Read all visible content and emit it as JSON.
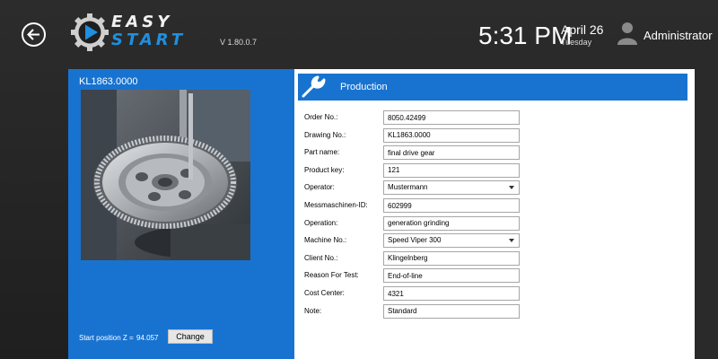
{
  "header": {
    "logo_line1": "EASY",
    "logo_line2": "START",
    "version": "V 1.80.0.7",
    "time": "5:31 PM",
    "date_month_day": "April 26",
    "date_weekday": "Tuesday",
    "user_name": "Administrator",
    "icons": {
      "back": "back-arrow-icon",
      "logo": "gear-play-logo-icon",
      "user": "user-icon"
    }
  },
  "left_panel": {
    "part_id": "KL1863.0000",
    "photo_subject": "gear-image",
    "start_position_label": "Start position Z =",
    "start_position_value": "94.057",
    "change_label": "Change"
  },
  "section": {
    "title": "Production",
    "icon": "wrench-icon"
  },
  "form": {
    "fields": [
      {
        "label": "Order No.:",
        "value": "8050.42499",
        "type": "text"
      },
      {
        "label": "Drawing No.:",
        "value": "KL1863.0000",
        "type": "text"
      },
      {
        "label": "Part name:",
        "value": "final drive gear",
        "type": "text"
      },
      {
        "label": "Product key:",
        "value": "121",
        "type": "text"
      },
      {
        "label": "Operator:",
        "value": "Mustermann",
        "type": "select"
      },
      {
        "label": "Messmaschinen-ID:",
        "value": "602999",
        "type": "text"
      },
      {
        "label": "Operation:",
        "value": "generation grinding",
        "type": "text"
      },
      {
        "label": "Machine No.:",
        "value": "Speed Viper 300",
        "type": "select"
      },
      {
        "label": "Client No.:",
        "value": "Klingelnberg",
        "type": "text"
      },
      {
        "label": "Reason For Test:",
        "value": "End-of-line",
        "type": "text"
      },
      {
        "label": "Cost Center:",
        "value": "4321",
        "type": "text"
      },
      {
        "label": "Note:",
        "value": "Standard",
        "type": "text"
      }
    ]
  },
  "colors": {
    "accent_blue": "#1873d0",
    "logo_blue": "#1f8fe0",
    "background_dark": "#262626"
  }
}
